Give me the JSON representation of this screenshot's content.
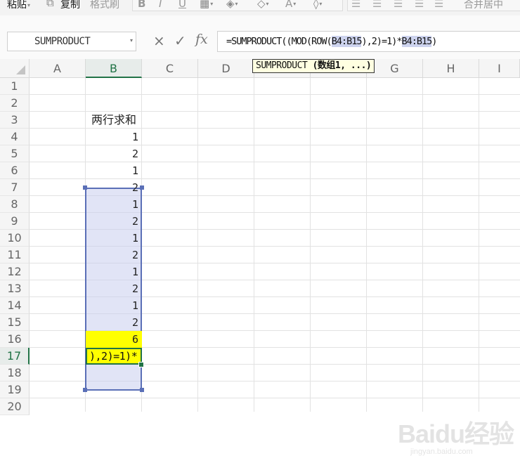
{
  "ribbon": {
    "paste_label": "粘贴",
    "copy_label": "复制",
    "format_painter_label": "格式刷",
    "merge_center_label": "合并居中"
  },
  "formula_bar": {
    "name_box_value": "SUMPRODUCT",
    "cancel_symbol": "×",
    "enter_symbol": "✓",
    "fx_symbol": "fx",
    "formula_parts": [
      "=SUMPRODUCT((MOD(ROW(",
      "B4:B15",
      "),2)=1)*",
      "B4:B15",
      ")"
    ]
  },
  "tooltip": {
    "func": "SUMPRODUCT",
    "args": "(数组1, ...)"
  },
  "columns": [
    "A",
    "B",
    "C",
    "D",
    "E",
    "F",
    "G",
    "H",
    "I"
  ],
  "rows": [
    "1",
    "2",
    "3",
    "4",
    "5",
    "6",
    "7",
    "8",
    "9",
    "10",
    "11",
    "12",
    "13",
    "14",
    "15",
    "16",
    "17",
    "18",
    "19",
    "20"
  ],
  "selected_column": "B",
  "selected_row": "17",
  "cells": {
    "B3": "两行求和",
    "B4_to_B15": [
      "1",
      "2",
      "1",
      "2",
      "1",
      "2",
      "1",
      "2",
      "1",
      "2",
      "1",
      "2"
    ],
    "B16": "6",
    "B17": "),2)=1)*"
  },
  "watermark": {
    "main": "Baidu经验",
    "sub": "jingyan.baidu.com"
  },
  "colors": {
    "selection_green": "#217346",
    "range_border": "#5a6fb7",
    "range_fill": "#c8ceee",
    "highlight_yellow": "#ffff00",
    "tooltip_bg": "#ffffe1"
  }
}
